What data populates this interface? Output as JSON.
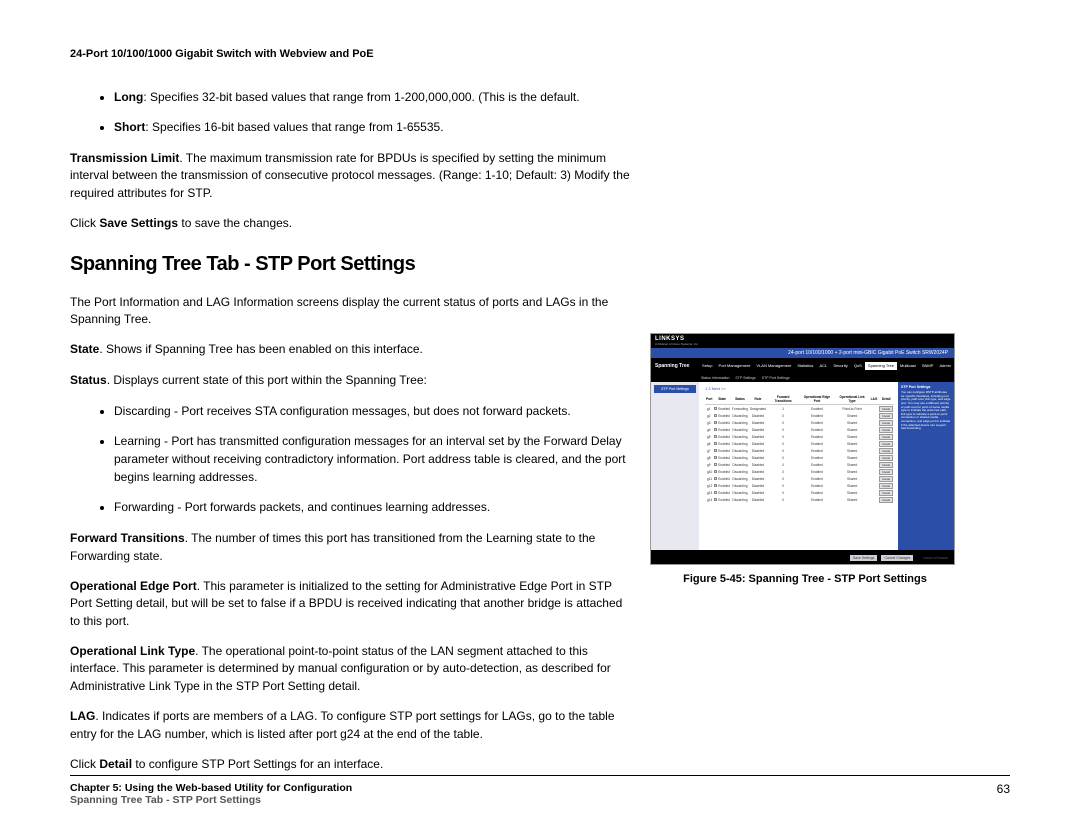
{
  "header": "24-Port 10/100/1000 Gigabit Switch with Webview and PoE",
  "intro_bullets": [
    {
      "bold": "Long",
      "rest": ": Specifies 32-bit based values that range from 1-200,000,000. (This is the default."
    },
    {
      "bold": "Short",
      "rest": ": Specifies 16-bit based values that range from 1-65535."
    }
  ],
  "transmission_limit": {
    "bold": "Transmission Limit",
    "rest": ". The maximum transmission rate for BPDUs is specified by setting the minimum interval between the transmission of consecutive protocol messages. (Range: 1-10; Default: 3) Modify the required attributes for STP."
  },
  "click_save": {
    "pre": "Click ",
    "bold": "Save Settings",
    "post": " to save the changes."
  },
  "section_title": "Spanning Tree Tab - STP Port Settings",
  "para_intro": "The Port Information and LAG Information screens display the current status of ports and LAGs in the Spanning Tree.",
  "state": {
    "bold": "State",
    "rest": ". Shows if Spanning Tree has been enabled on this interface."
  },
  "status": {
    "bold": "Status",
    "rest": ". Displays current state of this port within the Spanning Tree:"
  },
  "status_bullets": [
    "Discarding - Port receives STA configuration messages, but does not forward packets.",
    "Learning - Port has transmitted configuration messages for an interval set by the Forward Delay parameter without receiving contradictory information. Port address table is cleared, and the port begins learning addresses.",
    "Forwarding - Port forwards packets, and continues learning addresses."
  ],
  "forward_transitions": {
    "bold": "Forward Transitions",
    "rest": ". The number of times this port has transitioned from the Learning state to the Forwarding state."
  },
  "op_edge": {
    "bold": "Operational Edge Port",
    "rest": ". This parameter is initialized to the setting for Administrative Edge Port in STP Port Setting detail, but will be set to false if a BPDU is received indicating that another bridge is attached to this port."
  },
  "op_link": {
    "bold": "Operational Link Type",
    "rest": ". The operational point-to-point status of the LAN segment attached to this interface. This parameter is determined by manual configuration or by auto-detection, as described for Administrative Link Type in the STP Port Setting detail."
  },
  "lag": {
    "bold": "LAG",
    "rest": ". Indicates if ports are members of a LAG. To configure STP port settings for LAGs, go to the table entry for the LAG number, which is listed after port g24 at the end of the table."
  },
  "click_detail": {
    "pre": "Click ",
    "bold": "Detail",
    "post": " to configure STP Port Settings for an interface."
  },
  "figure_caption": "Figure 5-45: Spanning Tree - STP Port Settings",
  "footer": {
    "chapter": "Chapter 5: Using the Web-based Utility for Configuration",
    "sub": "Spanning Tree Tab - STP Port Settings",
    "page": "63"
  },
  "screenshot": {
    "logo": "LINKSYS",
    "logo_sub": "A Division of Cisco Systems, Inc.",
    "banner": "24-port 10/100/1000 + 2-port mini-GBIC Gigabit PoE Switch    SRW2024P",
    "nav_title": "Spanning Tree",
    "nav_items": [
      "Setup",
      "Port Management",
      "VLAN Management",
      "Statistics",
      "ACL",
      "Security",
      "QoS",
      "Spanning Tree",
      "Multicast",
      "SNMP",
      "Admin"
    ],
    "subnav": [
      "Status Information",
      "STP Settings",
      "STP Port Settings"
    ],
    "sidebar": "STP Port Settings",
    "pager": "1  2  Next >>",
    "headers": [
      "Port",
      "State",
      "Status",
      "Role",
      "Forward Transitions",
      "Operational Edge Port",
      "Operational Link Type",
      "LAG",
      "Detail"
    ],
    "rows": [
      [
        "g1",
        "Enabled",
        "Forwarding",
        "Designated",
        "1",
        "Enabled",
        "Point-to-Point",
        "",
        "Detail"
      ],
      [
        "g2",
        "Enabled",
        "Discarding",
        "Disabled",
        "0",
        "Enabled",
        "Shared",
        "",
        "Detail"
      ],
      [
        "g3",
        "Enabled",
        "Discarding",
        "Disabled",
        "0",
        "Enabled",
        "Shared",
        "",
        "Detail"
      ],
      [
        "g4",
        "Enabled",
        "Discarding",
        "Disabled",
        "0",
        "Enabled",
        "Shared",
        "",
        "Detail"
      ],
      [
        "g5",
        "Enabled",
        "Discarding",
        "Disabled",
        "0",
        "Enabled",
        "Shared",
        "",
        "Detail"
      ],
      [
        "g6",
        "Enabled",
        "Discarding",
        "Disabled",
        "0",
        "Enabled",
        "Shared",
        "",
        "Detail"
      ],
      [
        "g7",
        "Enabled",
        "Discarding",
        "Disabled",
        "0",
        "Enabled",
        "Shared",
        "",
        "Detail"
      ],
      [
        "g8",
        "Enabled",
        "Discarding",
        "Disabled",
        "0",
        "Enabled",
        "Shared",
        "",
        "Detail"
      ],
      [
        "g9",
        "Enabled",
        "Discarding",
        "Disabled",
        "0",
        "Enabled",
        "Shared",
        "",
        "Detail"
      ],
      [
        "g10",
        "Enabled",
        "Discarding",
        "Disabled",
        "0",
        "Enabled",
        "Shared",
        "",
        "Detail"
      ],
      [
        "g11",
        "Enabled",
        "Discarding",
        "Disabled",
        "0",
        "Enabled",
        "Shared",
        "",
        "Detail"
      ],
      [
        "g12",
        "Enabled",
        "Discarding",
        "Disabled",
        "0",
        "Enabled",
        "Shared",
        "",
        "Detail"
      ],
      [
        "g13",
        "Enabled",
        "Discarding",
        "Disabled",
        "0",
        "Enabled",
        "Shared",
        "",
        "Detail"
      ],
      [
        "g14",
        "Enabled",
        "Discarding",
        "Disabled",
        "0",
        "Enabled",
        "Shared",
        "",
        "Detail"
      ]
    ],
    "help_title": "STP Port Settings",
    "help_text": "You can configure RSTP attributes for specific interfaces, including port priority, path cost, link type, and edge port. You may use a different priority or path cost for ports of same media type to indicate the preferred path, link type to indicate a point-to-point connection or shared-media connection, and edge port to indicate if the attached device can support fast forwarding.",
    "btn_save": "Save Settings",
    "btn_cancel": "Cancel Changes",
    "cisco": "CISCO SYSTEMS"
  }
}
